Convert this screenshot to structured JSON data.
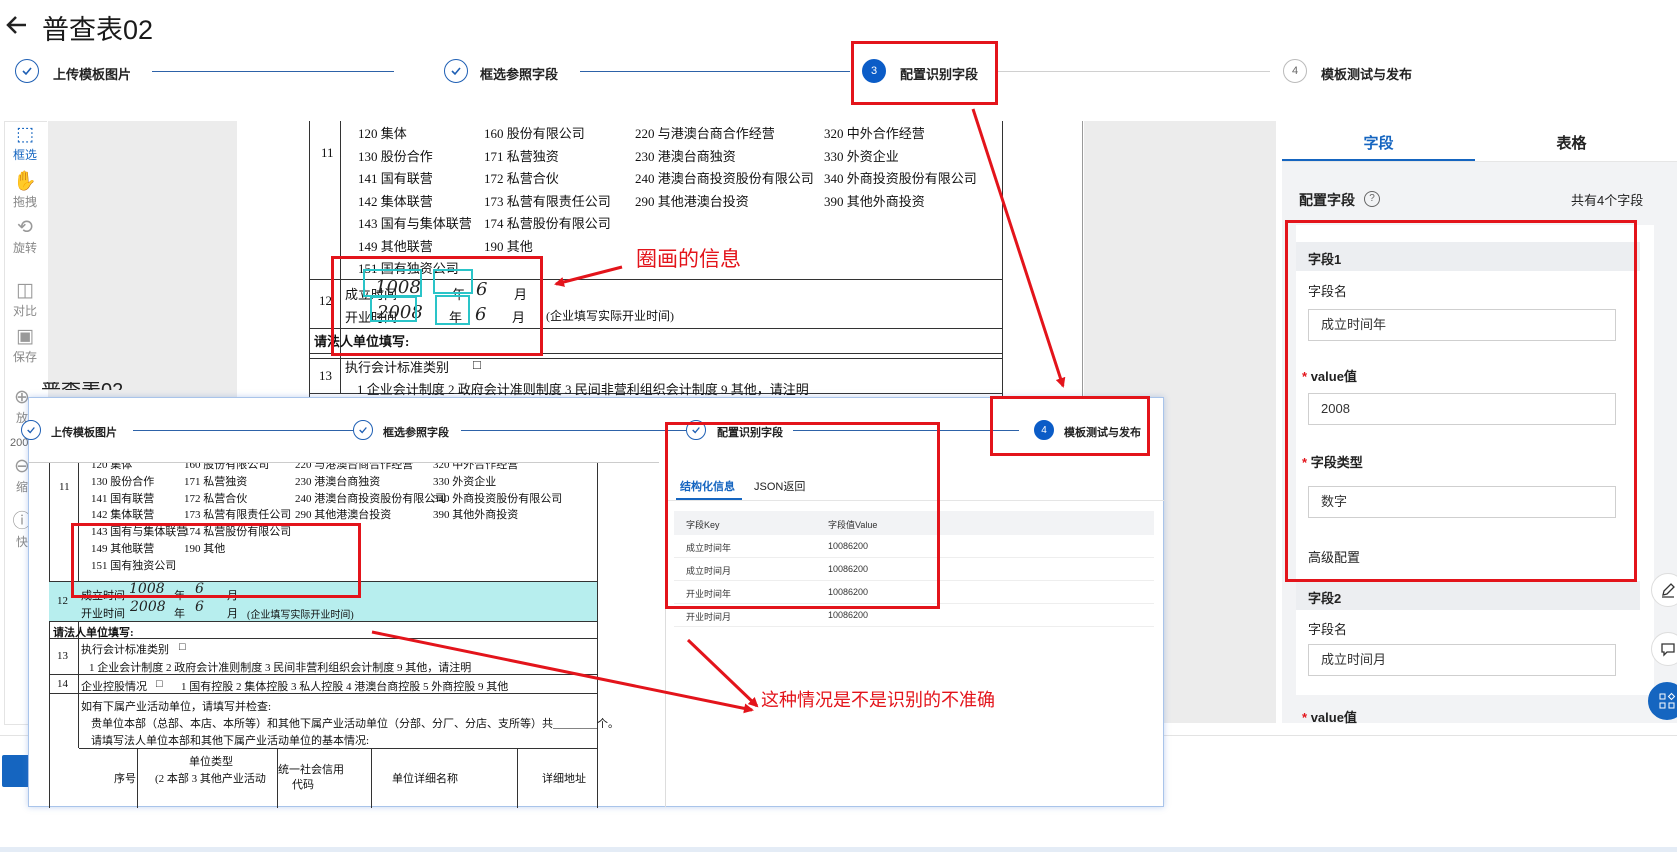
{
  "page": {
    "title": "普查表02"
  },
  "steps": [
    {
      "label": "上传模板图片",
      "state": "done"
    },
    {
      "label": "框选参照字段",
      "state": "done"
    },
    {
      "label": "配置识别字段",
      "state": "active",
      "num": "3"
    },
    {
      "label": "模板测试与发布",
      "state": "todo",
      "num": "4"
    }
  ],
  "toolbar": [
    {
      "label": "框选",
      "icon": "select-box-icon"
    },
    {
      "label": "拖拽",
      "icon": "hand-icon"
    },
    {
      "label": "旋转",
      "icon": "rotate-icon"
    },
    {
      "label": "对比",
      "icon": "compare-icon"
    },
    {
      "label": "保存",
      "icon": "save-icon"
    },
    {
      "label": "放",
      "icon": "zoom-in-icon"
    },
    {
      "label": "200",
      "icon": ""
    },
    {
      "label": "缩",
      "icon": "zoom-out-icon"
    },
    {
      "label": "快",
      "icon": "help-icon"
    }
  ],
  "doc": {
    "row11_num": "11",
    "codes_col1": [
      "120 集体",
      "130 股份合作",
      "141 国有联营",
      "142 集体联营",
      "143 国有与集体联营",
      "149 其他联营",
      "151 国有独资公司"
    ],
    "codes_col2": [
      "160 股份有限公司",
      "171 私营独资",
      "172 私营合伙",
      "173 私营有限责任公司",
      "174 私营股份有限公司",
      "190 其他"
    ],
    "codes_col3": [
      "220 与港澳台商合作经营",
      "230 港澳台商独资",
      "240 港澳台商投资股份有限公司",
      "290 其他港澳台投资"
    ],
    "codes_col4": [
      "320 中外合作经营",
      "330 外资企业",
      "340 外商投资股份有限公司",
      "390 其他外商投资"
    ],
    "row12_num": "12",
    "established_label": "成立时间",
    "opened_label": "开业时间",
    "year_unit": "年",
    "month_unit": "月",
    "hw_year1": "1008",
    "hw_month1": "6",
    "hw_year2": "2008",
    "hw_month2": "6",
    "opened_note": "(企业填写实际开业时间)",
    "legal_fill": "请法人单位填写:",
    "row13_num": "13",
    "row13_label": "执行会计标准类别",
    "row13_checkbox": "□",
    "row13_options": "1 企业会计制度    2 政府会计准则制度    3 民间非营利组织会计制度    9 其他，请注明"
  },
  "annotations": {
    "circled_info": "圈画的信息",
    "inaccurate_note": "这种情况是不是识别的不准确"
  },
  "panel": {
    "tab_fields": "字段",
    "tab_table": "表格",
    "config_title": "配置字段",
    "field_count": "共有4个字段",
    "field1": {
      "header": "字段1",
      "name_label": "字段名",
      "name_value": "成立时间年",
      "value_label": "value值",
      "value": "2008",
      "type_label": "字段类型",
      "type_value": "数字",
      "advanced": "高级配置"
    },
    "field2": {
      "header": "字段2",
      "name_label": "字段名",
      "name_value": "成立时间月",
      "value_label": "value值"
    },
    "required_mark": "*"
  },
  "overlay": {
    "title_partial": "普查表02",
    "steps": [
      {
        "label": "上传模板图片",
        "state": "done"
      },
      {
        "label": "框选参照字段",
        "state": "done"
      },
      {
        "label": "配置识别字段",
        "state": "done"
      },
      {
        "label": "模板测试与发布",
        "state": "active",
        "num": "4"
      }
    ],
    "result_tabs": [
      "结构化信息",
      "JSON返回"
    ],
    "table_headers": [
      "字段Key",
      "字段值Value"
    ],
    "table_rows": [
      {
        "key": "成立时间年",
        "value": "10086200"
      },
      {
        "key": "成立时间月",
        "value": "10086200"
      },
      {
        "key": "开业时间年",
        "value": "10086200"
      },
      {
        "key": "开业时间月",
        "value": "10086200"
      }
    ],
    "doc": {
      "codes_col1": [
        "120 集体",
        "130 股份合作",
        "141 国有联营",
        "142 集体联营",
        "143 国有与集体联营",
        "149 其他联营",
        "151 国有独资公司"
      ],
      "codes_col2": [
        "160 股份有限公司",
        "171 私营独资",
        "172 私营合伙",
        "173 私营有限责任公司",
        "174 私营股份有限公司",
        "190 其他"
      ],
      "codes_col3": [
        "220 与港澳台商合作经营",
        "230 港澳台商独资",
        "240 港澳台商投资股份有限公司",
        "290 其他港澳台投资"
      ],
      "codes_col4": [
        "320 中外合作经营",
        "330 外资企业",
        "340 外商投资股份有限公司",
        "390 其他外商投资"
      ],
      "row11": "11",
      "row12": "12",
      "row13": "13",
      "row14": "14",
      "line_est": "成立时间",
      "line_open": "开业时间",
      "year": "年",
      "month": "月",
      "hw_y1": "1008",
      "hw_y2": "2008",
      "hw_m": "6",
      "open_note": "(企业填写实际开业时间)",
      "legal_fill": "请法人单位填写:",
      "r13_label": "执行会计标准类别",
      "r13_box": "□",
      "r13_opts": "1 企业会计制度    2 政府会计准则制度    3 民间非营利组织会计制度    9 其他，请注明",
      "r14_label": "企业控股情况",
      "r14_box": "□",
      "r14_opts": "1 国有控股    2 集体控股    3 私人控股    4 港澳台商控股    5 外商控股    9 其他",
      "branch_q": "如有下属产业活动单位，请填写并检查:",
      "branch_line1": "贵单位本部（总部、本店、本所等）和其他下属产业活动单位（分部、分厂、分店、支所等）共________个。",
      "branch_line2": "请填写法人单位本部和其他下属产业活动单位的基本情况:",
      "th_seq": "序号",
      "th_type": "单位类型",
      "th_type_sub": "(2 本部  3 其他产业活动",
      "th_credit": "统一社会信用",
      "th_credit_sub": "代码",
      "th_name": "单位详细名称",
      "th_addr": "详细地址"
    }
  },
  "colors": {
    "accent": "#0b5cc7",
    "annotation_red": "#e3141b",
    "highlight_cyan": "#2ac4c8"
  }
}
